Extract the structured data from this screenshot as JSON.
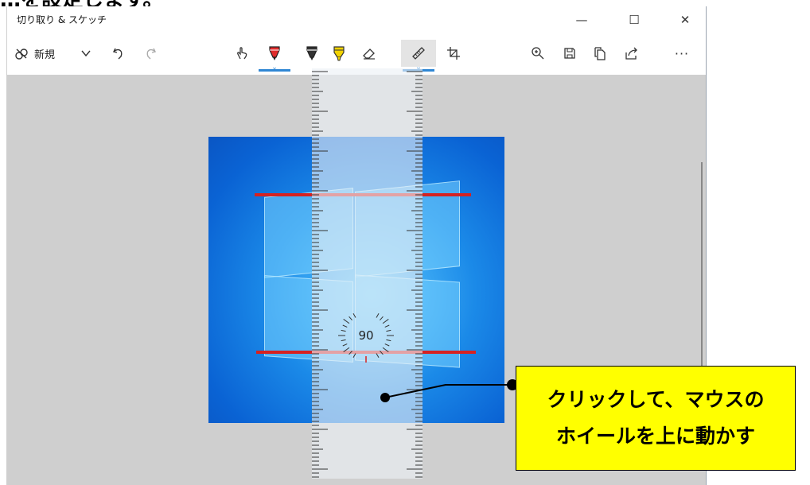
{
  "caption": "…を設定します。",
  "window": {
    "title": "切り取り & スケッチ",
    "controls": {
      "minimize": "—",
      "maximize": "☐",
      "close": "✕"
    }
  },
  "toolbar": {
    "new_label": "新規",
    "more_label": "···",
    "icons": [
      "new-snip-icon",
      "dropdown-chevron-icon",
      "undo-icon",
      "redo-icon",
      "touch-writing-icon",
      "ballpoint-pen-icon",
      "pencil-icon",
      "highlighter-icon",
      "eraser-icon",
      "ruler-icon",
      "crop-icon",
      "zoom-icon",
      "save-icon",
      "copy-icon",
      "share-icon",
      "more-icon"
    ],
    "selected_tools": [
      "ballpoint-pen",
      "ruler"
    ],
    "pen_color": "#e02b2b",
    "highlighter_color": "#f2d300",
    "accent": "#2f86d4"
  },
  "protractor": {
    "angle": "90"
  },
  "callout": {
    "line1": "クリックして、マウスの",
    "line2": "ホイールを上に動かす"
  }
}
